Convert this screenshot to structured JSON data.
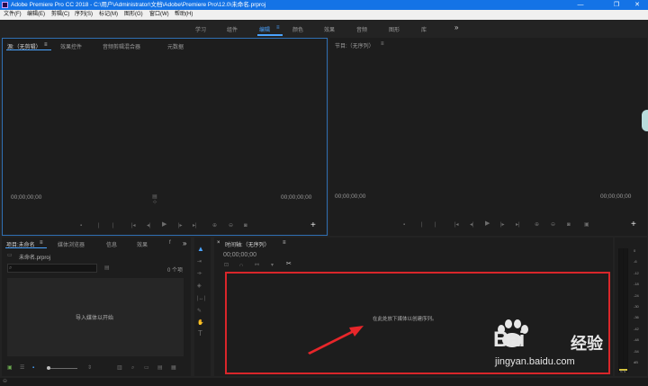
{
  "titlebar": {
    "title": "Adobe Premiere Pro CC 2018 - C:\\用户\\Administrator\\文档\\Adobe\\Premiere Pro\\12.0\\未命名.prproj",
    "minimize": "—",
    "maximize": "❐",
    "close": "✕"
  },
  "menu": [
    "文件(F)",
    "编辑(E)",
    "剪辑(C)",
    "序列(S)",
    "标记(M)",
    "图形(G)",
    "窗口(W)",
    "帮助(H)"
  ],
  "workspaces": {
    "items": [
      "学习",
      "组件",
      "编辑",
      "颜色",
      "效果",
      "音频",
      "图形",
      "库"
    ],
    "active": "编辑",
    "menu_glyph": "≡",
    "more": "»"
  },
  "source_panel": {
    "tabs": [
      "源:（无剪辑）",
      "效果控件",
      "音频剪辑混合器",
      "元数据"
    ],
    "tab_menu": "≡",
    "timecode_left": "00;00;00;00",
    "timecode_right": "00;00;00;00",
    "add": "+"
  },
  "program_panel": {
    "title": "节目:（无序列）",
    "tab_menu": "≡",
    "timecode_left": "00;00;00;00",
    "timecode_right": "00;00;00;00",
    "add": "+"
  },
  "project_panel": {
    "tabs": [
      "项目:未命名",
      "媒体浏览器",
      "信息",
      "效果",
      "f"
    ],
    "tab_menu": "≡",
    "more": "»",
    "file_name": "未命名.prproj",
    "search_placeholder": "",
    "item_count": "0 个项",
    "empty_text": "导入媒体以开始"
  },
  "timeline_panel": {
    "title": "时间轴:（无序列）",
    "close": "×",
    "tab_menu": "≡",
    "timecode": "00;00;00;00",
    "drop_text": "在此处放下媒体以创建序列。"
  },
  "meter": {
    "ticks": [
      "0",
      "-6",
      "-12",
      "-18",
      "-24",
      "-30",
      "-36",
      "-42",
      "-48",
      "-54",
      "dB"
    ],
    "bottom": "S S"
  },
  "watermark": {
    "brand": "Bai",
    "brand_cn": "经验",
    "url": "jingyan.baidu.com"
  },
  "colors": {
    "accent": "#4aa3ff",
    "titlebar": "#1473e6",
    "highlight_box": "#d9262a"
  }
}
